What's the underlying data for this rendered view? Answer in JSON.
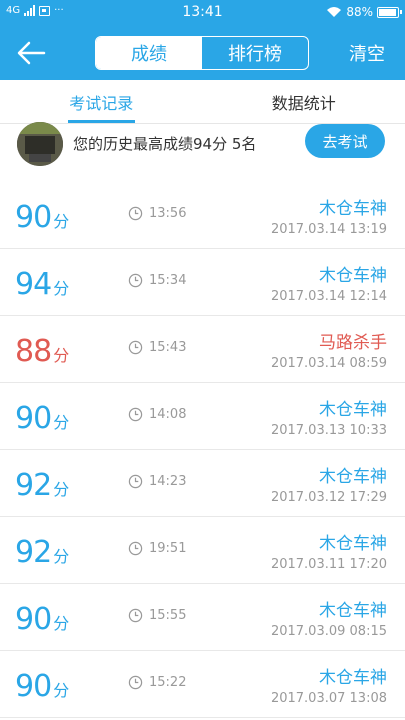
{
  "status": {
    "network": "4G",
    "time": "13:41",
    "dots": "···",
    "battery": "88%"
  },
  "header": {
    "segments": [
      "成绩",
      "排行榜"
    ],
    "active_segment": 0,
    "clear_label": "清空"
  },
  "tabs": [
    "考试记录",
    "数据统计"
  ],
  "summary": {
    "text": "您的历史最高成绩94分  5名",
    "exam_button": "去考试"
  },
  "records": [
    {
      "score": "90",
      "unit": "分",
      "duration": "13:56",
      "name": "木仓车神",
      "date": "2017.03.14  13:19",
      "status": "normal"
    },
    {
      "score": "94",
      "unit": "分",
      "duration": "15:34",
      "name": "木仓车神",
      "date": "2017.03.14  12:14",
      "status": "normal"
    },
    {
      "score": "88",
      "unit": "分",
      "duration": "15:43",
      "name": "马路杀手",
      "date": "2017.03.14  08:59",
      "status": "fail"
    },
    {
      "score": "90",
      "unit": "分",
      "duration": "14:08",
      "name": "木仓车神",
      "date": "2017.03.13  10:33",
      "status": "normal"
    },
    {
      "score": "92",
      "unit": "分",
      "duration": "14:23",
      "name": "木仓车神",
      "date": "2017.03.12  17:29",
      "status": "normal"
    },
    {
      "score": "92",
      "unit": "分",
      "duration": "19:51",
      "name": "木仓车神",
      "date": "2017.03.11  17:20",
      "status": "normal"
    },
    {
      "score": "90",
      "unit": "分",
      "duration": "15:55",
      "name": "木仓车神",
      "date": "2017.03.09  08:15",
      "status": "normal"
    },
    {
      "score": "90",
      "unit": "分",
      "duration": "15:22",
      "name": "木仓车神",
      "date": "2017.03.07  13:08",
      "status": "normal"
    }
  ],
  "colors": {
    "accent": "#2aa6e6",
    "fail": "#e05a52"
  }
}
